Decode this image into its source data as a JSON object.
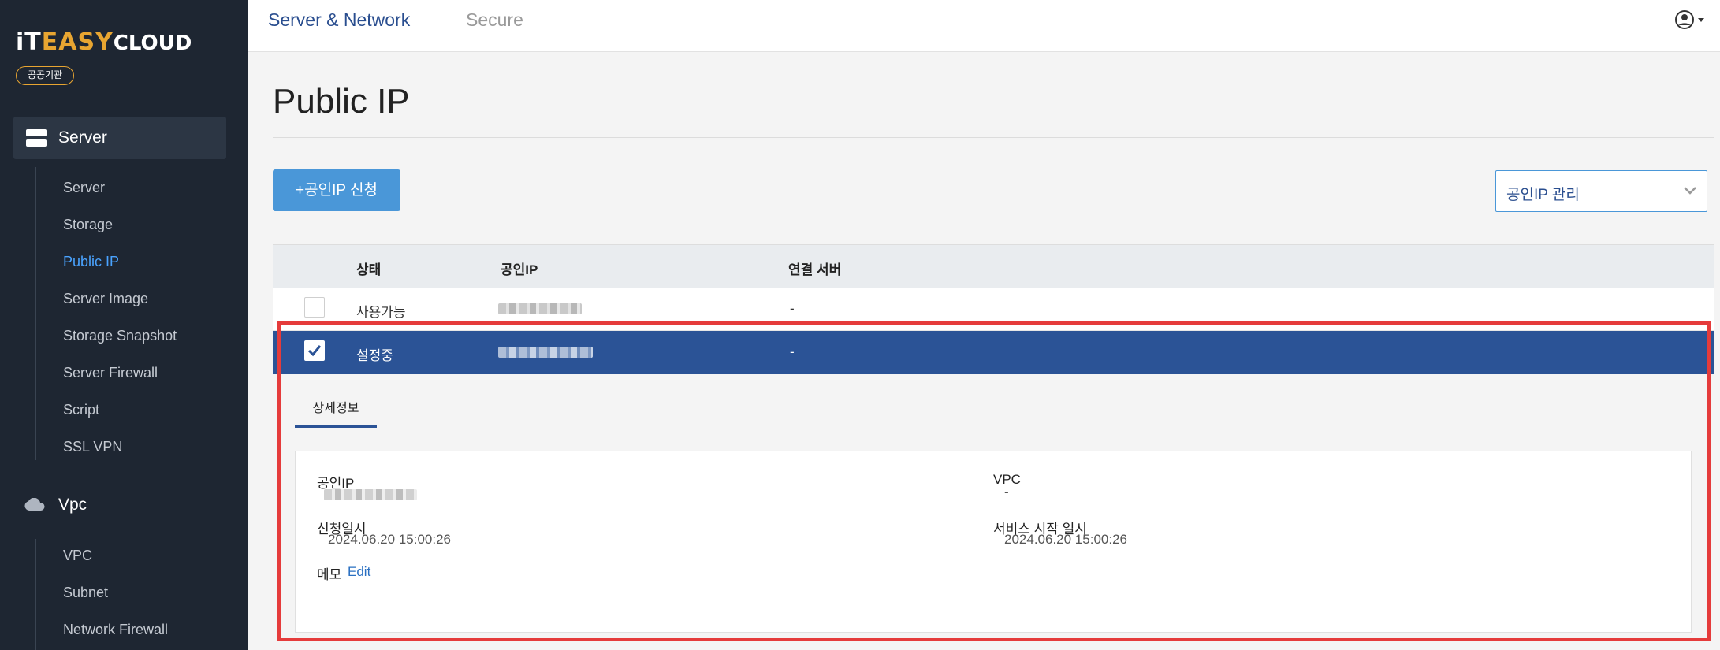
{
  "brand": {
    "logo_part1": "iT",
    "logo_part2": "EASY",
    "logo_part3": "CLOUD",
    "badge": "공공기관",
    "accent_color": "#e8a531"
  },
  "sidebar": {
    "server_group": {
      "label": "Server",
      "icon": "server-icon"
    },
    "server_items": [
      {
        "label": "Server"
      },
      {
        "label": "Storage"
      },
      {
        "label": "Public IP",
        "active": true
      },
      {
        "label": "Server Image"
      },
      {
        "label": "Storage Snapshot"
      },
      {
        "label": "Server Firewall"
      },
      {
        "label": "Script"
      },
      {
        "label": "SSL VPN"
      }
    ],
    "vpc_group": {
      "label": "Vpc",
      "icon": "cloud-icon"
    },
    "vpc_items": [
      {
        "label": "VPC"
      },
      {
        "label": "Subnet"
      },
      {
        "label": "Network Firewall"
      }
    ]
  },
  "topbar": {
    "tabs": [
      {
        "label": "Server & Network",
        "active": true
      },
      {
        "label": "Secure",
        "active": false
      }
    ],
    "user_icon": "user-circle-icon"
  },
  "page": {
    "title": "Public IP",
    "apply_button": "+공인IP 신청",
    "manage_select": "공인IP 관리"
  },
  "table": {
    "headers": [
      "상태",
      "공인IP",
      "연결 서버"
    ],
    "rows": [
      {
        "status": "사용가능",
        "server": "-",
        "selected": false
      },
      {
        "status": "설정중",
        "server": "-",
        "selected": true
      }
    ]
  },
  "detail": {
    "tab": "상세정보",
    "public_ip_label": "공인IP",
    "vpc_label": "VPC",
    "vpc_value": "-",
    "request_date_label": "신청일시",
    "request_date_value": "2024.06.20 15:00:26",
    "service_start_label": "서비스 시작 일시",
    "service_start_value": "2024.06.20 15:00:26",
    "memo_label": "메모",
    "memo_edit": "Edit"
  },
  "colors": {
    "sidebar_bg": "#1e2632",
    "selected_row": "#2b5396",
    "primary_button": "#4a97d8",
    "active_link": "#4aa3ff",
    "highlight_border": "#e53b3b"
  }
}
